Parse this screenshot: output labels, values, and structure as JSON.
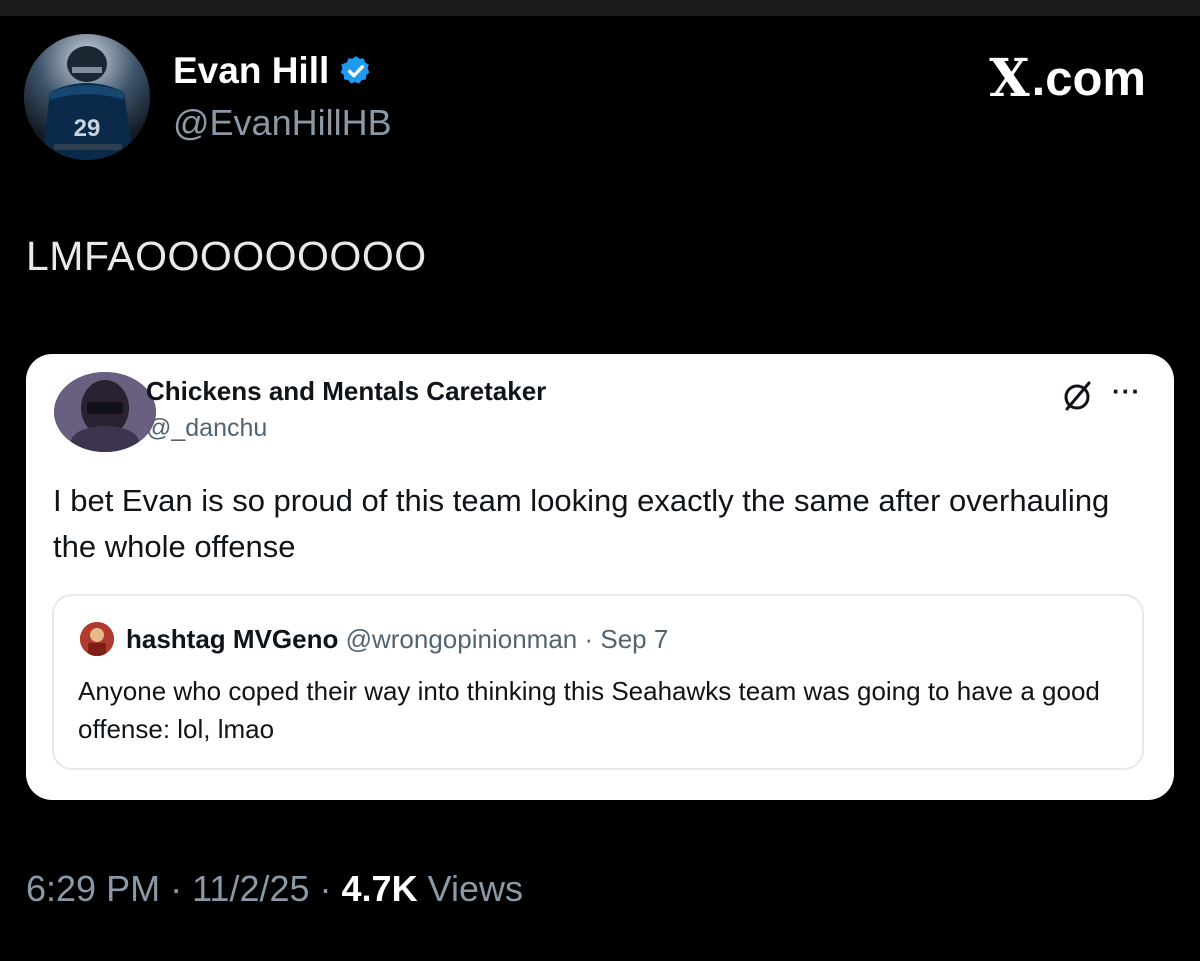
{
  "author": {
    "name": "Evan Hill",
    "handle": "@EvanHillHB",
    "verified": true,
    "avatar_jersey_number": "29"
  },
  "brand": {
    "logo_letter": "X",
    "suffix": ".com"
  },
  "tweet": {
    "text": "LMFAOOOOOOOOO"
  },
  "quoted_tweet": {
    "name": "Chickens and Mentals Caretaker",
    "handle": "@_danchu",
    "more_label": "···",
    "text": "I bet Evan is so proud of this team looking exactly the same after overhauling the whole offense",
    "nested_quote": {
      "name": "hashtag MVGeno",
      "handle": "@wrongopinionman",
      "separator": "·",
      "date": "Sep 7",
      "text": "Anyone who coped their way into thinking this Seahawks team was going to have a good offense: lol, lmao"
    }
  },
  "meta": {
    "time": "6:29 PM",
    "separator": " · ",
    "date": "11/2/25",
    "views_count": "4.7K",
    "views_label": "Views"
  },
  "colors": {
    "background": "#000000",
    "primary_text": "#e7e9ea",
    "secondary_text": "#8b98a5",
    "verified_blue": "#1d9bf0",
    "card_background": "#ffffff"
  },
  "icons": [
    "verified-badge-icon",
    "x-logo-icon",
    "grok-icon",
    "more-icon"
  ]
}
